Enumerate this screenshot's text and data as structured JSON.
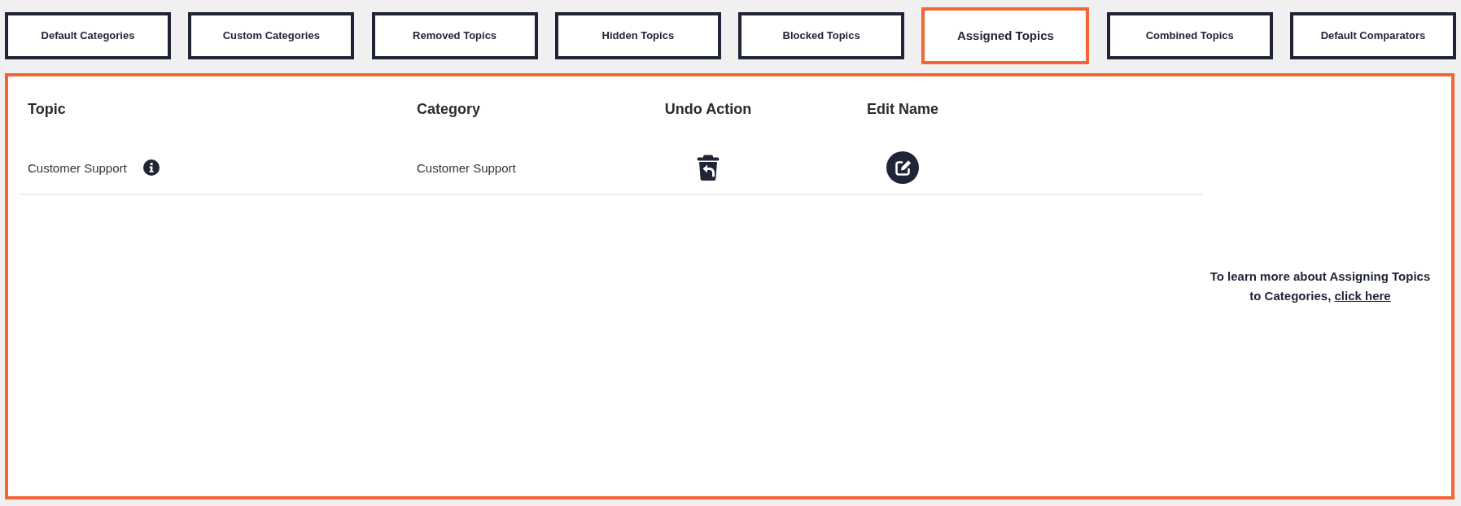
{
  "tabs": [
    {
      "label": "Default Categories",
      "selected": false
    },
    {
      "label": "Custom Categories",
      "selected": false
    },
    {
      "label": "Removed Topics",
      "selected": false
    },
    {
      "label": "Hidden Topics",
      "selected": false
    },
    {
      "label": "Blocked Topics",
      "selected": false
    },
    {
      "label": "Assigned Topics",
      "selected": true
    },
    {
      "label": "Combined Topics",
      "selected": false
    },
    {
      "label": "Default Comparators",
      "selected": false
    }
  ],
  "table": {
    "columns": [
      "Topic",
      "Category",
      "Undo Action",
      "Edit Name"
    ],
    "rows": [
      {
        "topic": "Customer Support",
        "category": "Customer Support"
      }
    ]
  },
  "help": {
    "text": "To learn more about Assigning Topics to Categories,",
    "link": "click here"
  }
}
